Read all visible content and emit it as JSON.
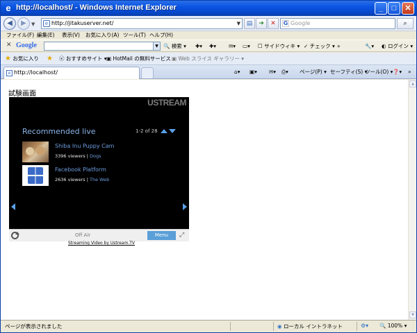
{
  "window": {
    "title": "http://localhost/ - Windows Internet Explorer",
    "minimize_glyph": "_",
    "maximize_glyph": "□",
    "close_glyph": "✕"
  },
  "address_bar": {
    "url": "http://jitakuserver.net/",
    "search_placeholder": "Google",
    "search_glyph": "⌕"
  },
  "menu": {
    "items": [
      "ファイル(F)",
      "編集(E)",
      "表示(V)",
      "お気に入り(A)",
      "ツール(T)",
      "ヘルプ(H)"
    ]
  },
  "google_toolbar": {
    "logo": "Google",
    "search_label": "検索",
    "sidewiki_label": "サイドウィキ",
    "check_label": "チェック",
    "more_label": "»",
    "login_label": "ログイン"
  },
  "favorites_bar": {
    "favorites_label": "お気に入り",
    "suggested_sites": "おすすめサイト",
    "hotmail": "HotMail の無料サービス",
    "web_slice_gallery": "Web スライス ギャラリー"
  },
  "tabs": {
    "active_tab": "http://localhost/"
  },
  "command_bar": {
    "page_label": "ページ(P)",
    "safety_label": "セーフティ(S)",
    "tools_label": "ツール(O)",
    "more_label": "»"
  },
  "page": {
    "heading": "試験画面",
    "credit_link": "Streaming Video by Ustream.TV"
  },
  "player": {
    "brand": "USTREAM",
    "section_title": "Recommended live",
    "pager": "1-2 of 28",
    "items": [
      {
        "name": "Shiba Inu Puppy Cam",
        "viewers": "3396 viewers",
        "separator": "|",
        "category": "Dogs"
      },
      {
        "name": "Facebook Platform",
        "viewers": "2636 viewers",
        "separator": "|",
        "category": "The Web"
      }
    ],
    "status": "Off Air",
    "menu_button": "Menu"
  },
  "status_bar": {
    "message": "ページが表示されました",
    "zone": "ローカル イントラネット",
    "zoom": "100%"
  },
  "colors": {
    "titlebar": "#0a54e3",
    "player_bg": "#000000",
    "player_accent": "#5aa0e8",
    "menu_button": "#5a9fd8"
  }
}
